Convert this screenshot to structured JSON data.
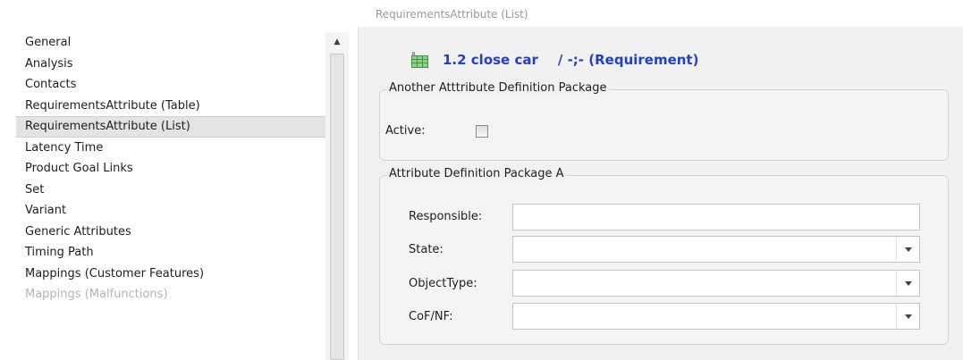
{
  "window": {
    "title": "RequirementsAttribute (List)"
  },
  "sidebar": {
    "items": [
      {
        "label": "General"
      },
      {
        "label": "Analysis"
      },
      {
        "label": "Contacts"
      },
      {
        "label": "RequirementsAttribute (Table)"
      },
      {
        "label": "RequirementsAttribute (List)",
        "selected": true
      },
      {
        "label": "Latency Time"
      },
      {
        "label": "Product Goal Links"
      },
      {
        "label": "Set"
      },
      {
        "label": "Variant"
      },
      {
        "label": "Generic Attributes"
      },
      {
        "label": "Timing Path"
      },
      {
        "label": "Mappings (Customer Features)"
      },
      {
        "label": "Mappings (Malfunctions)"
      }
    ]
  },
  "header": {
    "icon": "requirement-grid-icon",
    "title": "1.2 close car",
    "suffix": "/ -;- (Requirement)",
    "color": "#1f3fd1"
  },
  "groups": {
    "another": {
      "title": "Another Atttribute Definition Package",
      "active_label": "Active:",
      "active_checked": false
    },
    "package_a": {
      "title": "Attribute Definition Package A",
      "fields": {
        "responsible": {
          "label": "Responsible:",
          "value": ""
        },
        "state": {
          "label": "State:",
          "value": ""
        },
        "object_type": {
          "label": "ObjectType:",
          "value": ""
        },
        "cof_nf": {
          "label": "CoF/NF:",
          "value": ""
        }
      }
    }
  }
}
